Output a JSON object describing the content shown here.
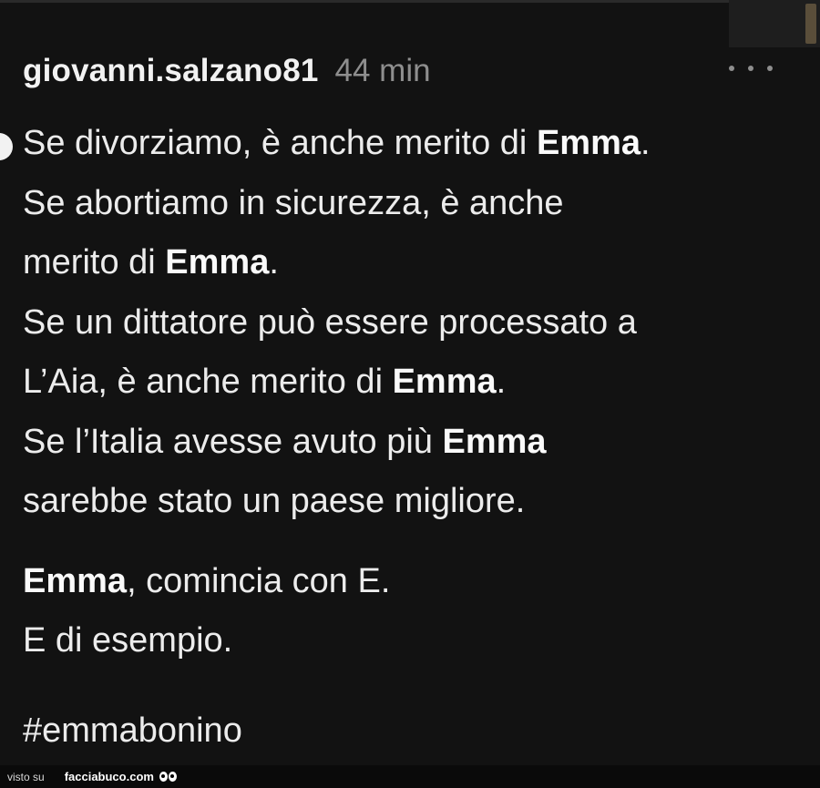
{
  "post": {
    "username": "giovanni.salzano81",
    "timestamp": "44 min",
    "lines": [
      [
        {
          "t": "Se divorziamo, è anche merito di "
        },
        {
          "t": "Emma",
          "b": true
        },
        {
          "t": "."
        }
      ],
      [
        {
          "t": "Se abortiamo in sicurezza, è anche"
        }
      ],
      [
        {
          "t": "merito di "
        },
        {
          "t": "Emma",
          "b": true
        },
        {
          "t": "."
        }
      ],
      [
        {
          "t": "Se un dittatore può essere processato a"
        }
      ],
      [
        {
          "t": "L’Aia, è anche merito di "
        },
        {
          "t": "Emma",
          "b": true
        },
        {
          "t": "."
        }
      ],
      [
        {
          "t": "Se l’Italia avesse avuto più "
        },
        {
          "t": "Emma",
          "b": true
        }
      ],
      [
        {
          "t": "sarebbe stato un paese migliore."
        }
      ],
      [],
      [
        {
          "t": "Emma",
          "b": true
        },
        {
          "t": ", comincia con E."
        }
      ],
      [
        {
          "t": "E di esempio."
        }
      ]
    ],
    "hashtag": "#emmabonino"
  },
  "footer": {
    "visto_su": "visto su",
    "site": "facciabuco.com"
  },
  "icons": {
    "more": "more-horizontal-icon",
    "logo": "eyes-logo-icon"
  }
}
